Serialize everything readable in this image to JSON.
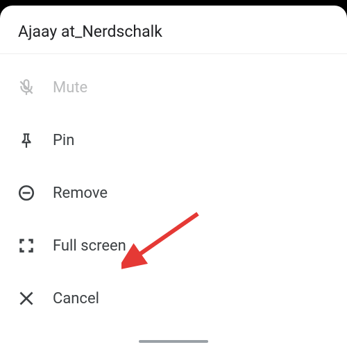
{
  "header": {
    "title": "Ajaay at_Nerdschalk"
  },
  "menu": {
    "mute": {
      "label": "Mute"
    },
    "pin": {
      "label": "Pin"
    },
    "remove": {
      "label": "Remove"
    },
    "fullscreen": {
      "label": "Full screen"
    },
    "cancel": {
      "label": "Cancel"
    }
  },
  "annotation": {
    "color": "#e53935"
  }
}
